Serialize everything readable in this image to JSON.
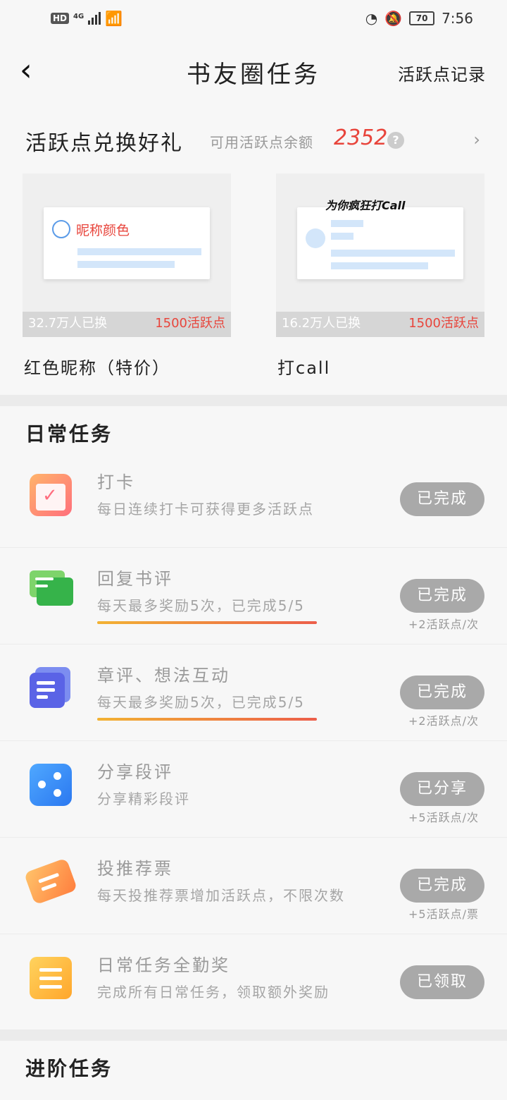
{
  "status_bar": {
    "hd": "HD",
    "network": "4G",
    "battery": "70",
    "time": "7:56"
  },
  "header": {
    "back_label": "‹",
    "title": "书友圈任务",
    "record_label": "活跃点记录"
  },
  "exchange": {
    "title": "活跃点兑换好礼",
    "balance_label": "可用活跃点余额",
    "balance": "2352",
    "help_label": "?",
    "more_label": "›",
    "items": [
      {
        "name": "红色昵称（特价）",
        "preview_text": "昵称颜色",
        "count": "32.7万人已换",
        "price": "1500活跃点"
      },
      {
        "name": "打call",
        "preview_text": "为你疯狂打Call",
        "count": "16.2万人已换",
        "price": "1500活跃点"
      }
    ]
  },
  "daily": {
    "title": "日常任务",
    "tasks": [
      {
        "icon": "calendar-icon",
        "name": "打卡",
        "desc": "每日连续打卡可获得更多活跃点",
        "button": "已完成",
        "reward": ""
      },
      {
        "icon": "chat-icon",
        "name": "回复书评",
        "desc": "每天最多奖励5次，已完成5/5",
        "button": "已完成",
        "reward": "+2活跃点/次"
      },
      {
        "icon": "document-icon",
        "name": "章评、想法互动",
        "desc": "每天最多奖励5次，已完成5/5",
        "button": "已完成",
        "reward": "+2活跃点/次"
      },
      {
        "icon": "share-icon",
        "name": "分享段评",
        "desc": "分享精彩段评",
        "button": "已分享",
        "reward": "+5活跃点/次"
      },
      {
        "icon": "ticket-icon",
        "name": "投推荐票",
        "desc": "每天投推荐票增加活跃点，不限次数",
        "button": "已完成",
        "reward": "+5活跃点/票"
      },
      {
        "icon": "list-icon",
        "name": "日常任务全勤奖",
        "desc": "完成所有日常任务，领取额外奖励",
        "button": "已领取",
        "reward": ""
      }
    ]
  },
  "advanced": {
    "title": "进阶任务"
  },
  "colors": {
    "accent_red": "#e8453c",
    "button_gray": "#a9a9a9"
  }
}
